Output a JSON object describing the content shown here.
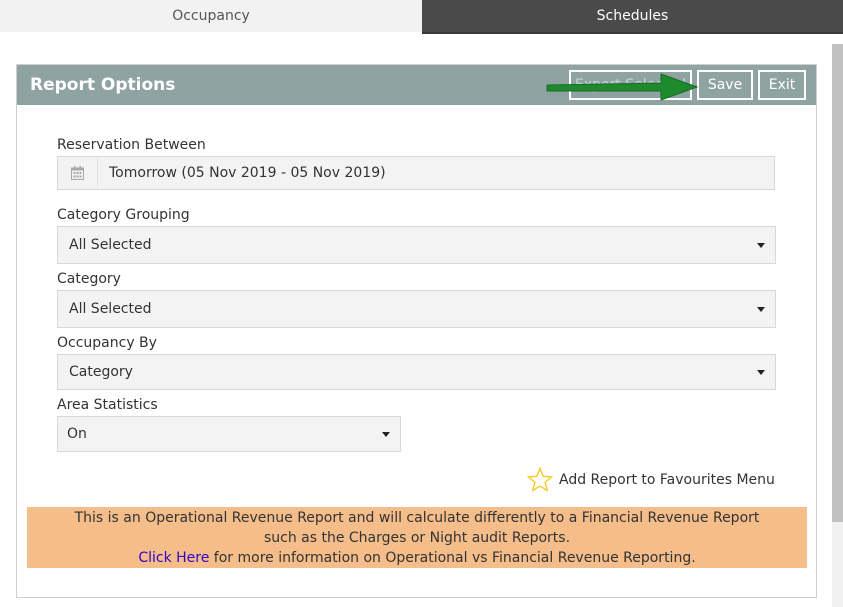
{
  "tabs": [
    {
      "label": "Occupancy"
    },
    {
      "label": "Schedules"
    }
  ],
  "panel": {
    "title": "Report Options",
    "buttons": {
      "export_label": "Export Selected",
      "save_label": "Save",
      "exit_label": "Exit"
    }
  },
  "fields": {
    "reservation_between": {
      "label": "Reservation Between",
      "value": "Tomorrow (05 Nov 2019 - 05 Nov 2019)"
    },
    "category_grouping": {
      "label": "Category Grouping",
      "value": "All Selected"
    },
    "category": {
      "label": "Category",
      "value": "All Selected"
    },
    "occupancy_by": {
      "label": "Occupancy By",
      "value": "Category"
    },
    "area_statistics": {
      "label": "Area Statistics",
      "value": "On"
    }
  },
  "favourites": {
    "label": "Add Report to Favourites Menu"
  },
  "notice": {
    "line1": "This is an Operational Revenue Report and will calculate differently to a Financial Revenue Report",
    "line2": "such as the Charges or Night audit Reports.",
    "link_text": "Click Here",
    "line3_rest": " for more information on Operational vs Financial Revenue Reporting."
  },
  "colors": {
    "header_bg": "#8fa3a3",
    "notice_bg": "#f4bd8a",
    "arrow": "#1e8a2e",
    "star": "#f5c518",
    "link": "#3300cc"
  }
}
